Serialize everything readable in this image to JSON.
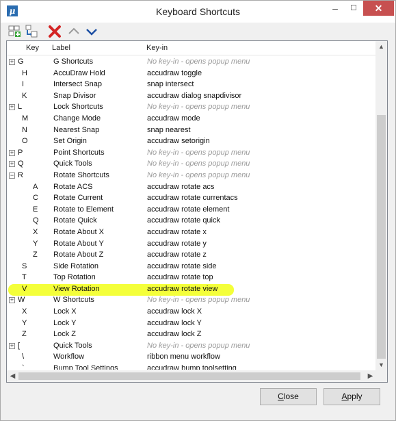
{
  "window": {
    "title": "Keyboard Shortcuts",
    "app_icon_letter": "μ",
    "minimize_glyph": "–",
    "maximize_glyph": "☐",
    "close_glyph": "✕"
  },
  "toolbar": {
    "icons": [
      "add-shortcut-icon",
      "add-child-shortcut-icon",
      "delete-icon",
      "move-up-icon",
      "move-down-icon"
    ]
  },
  "columns": {
    "key": "Key",
    "label": "Label",
    "keyin": "Key-in"
  },
  "rows": [
    {
      "expander": "+",
      "key": "G",
      "label": "G Shortcuts",
      "keyin": "No key-in - opens popup menu",
      "muted": true
    },
    {
      "expander": "",
      "key": "H",
      "label": "AccuDraw Hold",
      "keyin": "accudraw toggle",
      "muted": false
    },
    {
      "expander": "",
      "key": "I",
      "label": "Intersect Snap",
      "keyin": "snap intersect",
      "muted": false
    },
    {
      "expander": "",
      "key": "K",
      "label": "Snap Divisor",
      "keyin": "accudraw dialog snapdivisor",
      "muted": false
    },
    {
      "expander": "+",
      "key": "L",
      "label": "Lock Shortcuts",
      "keyin": "No key-in - opens popup menu",
      "muted": true
    },
    {
      "expander": "",
      "key": "M",
      "label": "Change Mode",
      "keyin": "accudraw mode",
      "muted": false
    },
    {
      "expander": "",
      "key": "N",
      "label": "Nearest Snap",
      "keyin": "snap nearest",
      "muted": false
    },
    {
      "expander": "",
      "key": "O",
      "label": "Set Origin",
      "keyin": "accudraw setorigin",
      "muted": false
    },
    {
      "expander": "+",
      "key": "P",
      "label": "Point Shortcuts",
      "keyin": "No key-in - opens popup menu",
      "muted": true
    },
    {
      "expander": "+",
      "key": "Q",
      "label": "Quick Tools",
      "keyin": "No key-in - opens popup menu",
      "muted": true
    },
    {
      "expander": "−",
      "key": "R",
      "label": "Rotate Shortcuts",
      "keyin": "No key-in - opens popup menu",
      "muted": true
    },
    {
      "expander": "",
      "key": "A",
      "label": "Rotate ACS",
      "keyin": "accudraw rotate acs",
      "muted": false,
      "child": true
    },
    {
      "expander": "",
      "key": "C",
      "label": "Rotate Current",
      "keyin": "accudraw rotate currentacs",
      "muted": false,
      "child": true
    },
    {
      "expander": "",
      "key": "E",
      "label": "Rotate to Element",
      "keyin": "accudraw rotate element",
      "muted": false,
      "child": true
    },
    {
      "expander": "",
      "key": "Q",
      "label": "Rotate Quick",
      "keyin": "accudraw rotate quick",
      "muted": false,
      "child": true
    },
    {
      "expander": "",
      "key": "X",
      "label": "Rotate About X",
      "keyin": "accudraw rotate x",
      "muted": false,
      "child": true
    },
    {
      "expander": "",
      "key": "Y",
      "label": "Rotate About Y",
      "keyin": "accudraw rotate y",
      "muted": false,
      "child": true
    },
    {
      "expander": "",
      "key": "Z",
      "label": "Rotate About Z",
      "keyin": "accudraw rotate z",
      "muted": false,
      "child": true
    },
    {
      "expander": "",
      "key": "S",
      "label": "Side Rotation",
      "keyin": "accudraw rotate side",
      "muted": false
    },
    {
      "expander": "",
      "key": "T",
      "label": "Top Rotation",
      "keyin": "accudraw rotate top",
      "muted": false
    },
    {
      "expander": "",
      "key": "V",
      "label": "View Rotation",
      "keyin": "accudraw rotate view",
      "muted": false,
      "highlight": true
    },
    {
      "expander": "+",
      "key": "W",
      "label": "W Shortcuts",
      "keyin": "No key-in - opens popup menu",
      "muted": true
    },
    {
      "expander": "",
      "key": "X",
      "label": "Lock X",
      "keyin": "accudraw lock X",
      "muted": false
    },
    {
      "expander": "",
      "key": "Y",
      "label": "Lock Y",
      "keyin": "accudraw lock Y",
      "muted": false
    },
    {
      "expander": "",
      "key": "Z",
      "label": "Lock Z",
      "keyin": "accudraw lock Z",
      "muted": false
    },
    {
      "expander": "+",
      "key": "[",
      "label": "Quick Tools",
      "keyin": "No key-in - opens popup menu",
      "muted": true
    },
    {
      "expander": "",
      "key": "\\",
      "label": "Workflow",
      "keyin": "ribbon menu workflow",
      "muted": false
    },
    {
      "expander": "",
      "key": "`",
      "label": "Bump Tool Settings",
      "keyin": "accudraw bump toolsetting",
      "muted": false
    }
  ],
  "highlight_color": "#f4ff3a",
  "buttons": {
    "close": {
      "first": "C",
      "rest": "lose"
    },
    "apply": {
      "first": "A",
      "rest": "pply"
    }
  },
  "colors": {
    "close_button_bg": "#c75050",
    "muted_text": "#9a9a9a"
  }
}
